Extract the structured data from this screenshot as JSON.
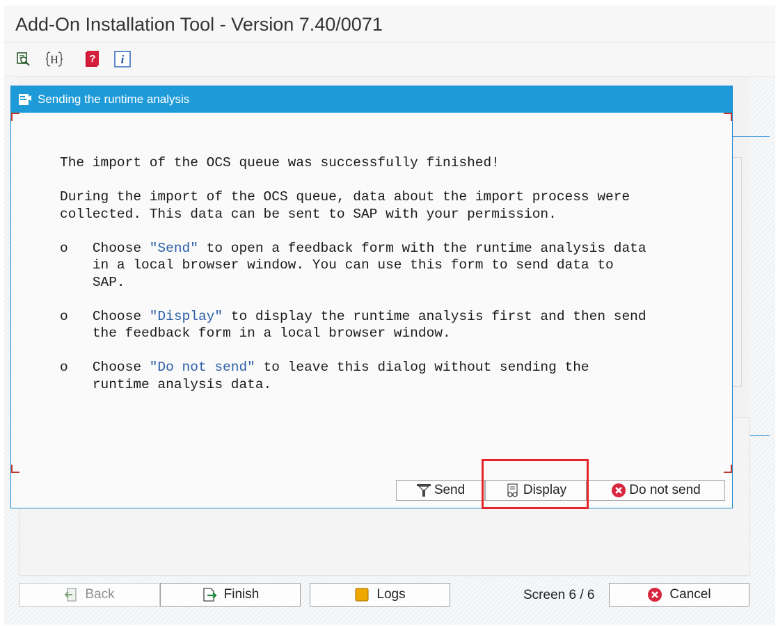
{
  "app": {
    "title": "Add-On Installation Tool - Version 7.40/0071"
  },
  "toolbar": {
    "icons": [
      "find-icon",
      "header-icon",
      "help-icon",
      "info-icon"
    ],
    "header_glyph": "H",
    "help_glyph": "?",
    "info_glyph": "i"
  },
  "dialog": {
    "title": "Sending the runtime analysis",
    "message": {
      "line1": "The import of the OCS queue was successfully finished!",
      "p2_line1": "During the import of the OCS queue, data about the import process were",
      "p2_line2": "collected. This data can be sent to SAP with your permission.",
      "bullet": "o",
      "b1_pre": "Choose ",
      "b1_key": "\"Send\"",
      "b1_post": " to open a feedback form with the runtime analysis data",
      "b1_line2": "in a local browser window. You can use this form to send data to",
      "b1_line3": "SAP.",
      "b2_pre": "Choose ",
      "b2_key": "\"Display\"",
      "b2_post": " to display the runtime analysis first and then send",
      "b2_line2": "the feedback form in a local browser window.",
      "b3_pre": "Choose ",
      "b3_key": "\"Do not send\"",
      "b3_post": " to leave this dialog without sending the",
      "b3_line2": "runtime analysis data."
    },
    "buttons": {
      "send": "Send",
      "display": "Display",
      "do_not_send": "Do not send"
    }
  },
  "footer": {
    "back": "Back",
    "finish": "Finish",
    "logs": "Logs",
    "screen": "Screen 6 / 6",
    "cancel": "Cancel"
  },
  "colors": {
    "dialog_header": "#1e9ad8",
    "highlight_box": "#e3242b",
    "cancel_icon": "#d7263d"
  }
}
